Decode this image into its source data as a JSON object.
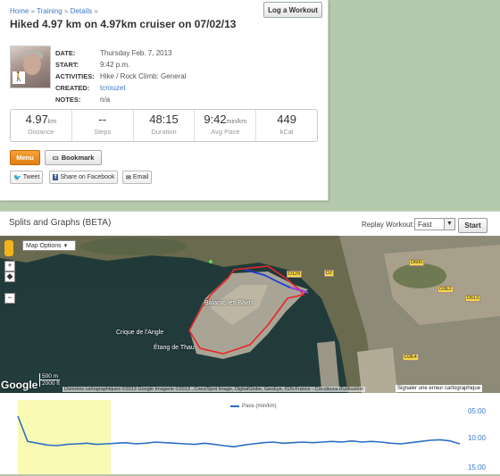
{
  "breadcrumb": {
    "home": "Home",
    "training": "Training",
    "details": "Details",
    "sep": "»"
  },
  "header": {
    "title": "Hiked 4.97 km on 4.97km cruiser on 07/02/13",
    "log_workout": "Log a Workout"
  },
  "meta": {
    "date_label": "DATE:",
    "date_value": "Thursday Feb. 7, 2013",
    "start_label": "START:",
    "start_value": "9:42 p.m.",
    "activities_label": "ACTIVITIES:",
    "activities_value": "Hike / Rock Climb: General",
    "created_label": "CREATED:",
    "created_value": "tcrouzet",
    "notes_label": "NOTES:",
    "notes_value": "n/a"
  },
  "stats": [
    {
      "value": "4.97",
      "unit": "km",
      "label": "Distance"
    },
    {
      "value": "--",
      "unit": "",
      "label": "Steps"
    },
    {
      "value": "48:15",
      "unit": "",
      "label": "Duration"
    },
    {
      "value": "9:42",
      "unit": "min/km",
      "label": "Avg Pace"
    },
    {
      "value": "449",
      "unit": "",
      "label": "kCal"
    }
  ],
  "actions": {
    "menu": "Menu",
    "bookmark": "Bookmark",
    "tweet": "Tweet",
    "facebook": "Share on Facebook",
    "email": "Email"
  },
  "splits": {
    "title": "Splits and Graphs (BETA)",
    "replay_label": "Replay Workout:",
    "replay_value": "Fast",
    "start": "Start"
  },
  "map": {
    "options": "Map Options",
    "google": "Google",
    "scale_m": "500 m",
    "scale_ft": "2000 ft",
    "attribution": "Données cartographiques ©2013 Google Imagerie ©2013 , Cnes/Spot Image, DigitalGlobe, GeoEye, IGN-France - Conditions d'utilisation",
    "report_error": "Signaler une erreur cartographique",
    "town": "Balaruc-les-Bains",
    "lagoon1": "Crique de l'Angle",
    "lagoon2": "Étang de Thau",
    "roads": [
      "D129",
      "D2",
      "D600",
      "D2E2",
      "D613",
      "D2E4"
    ],
    "colors": {
      "route_red": "#e8262b",
      "route_blue": "#1d3fd6",
      "route_purple": "#a73ad8"
    }
  },
  "chart_data": {
    "type": "line",
    "series": [
      {
        "name": "Pace (min/km)",
        "color": "#2a6fc4",
        "values": [
          5.6,
          9.9,
          10.2,
          10.5,
          10.6,
          10.4,
          10.3,
          10.2,
          10.4,
          10.3,
          10.2,
          10.1,
          10.3,
          10.2,
          10.0,
          10.1,
          10.2,
          10.3,
          10.4,
          10.2,
          10.4,
          10.6,
          10.8,
          10.5,
          10.3,
          10.1,
          10.0,
          10.2,
          10.1,
          10.0,
          10.1,
          10.0,
          9.9,
          10.0,
          9.8,
          10.0,
          9.9,
          10.0,
          10.2,
          10.3,
          10.1,
          9.9,
          9.7,
          9.6,
          9.8,
          10.3
        ]
      }
    ],
    "y_ticks": [
      "05:00",
      "10:00",
      "15:00"
    ],
    "ylim": [
      5,
      15
    ],
    "y_inverted": true,
    "highlight": {
      "from": 0.0,
      "to": 0.21
    },
    "colors": {
      "line": "#2a6fc4",
      "highlight": "#fafab4",
      "axis_text": "#3a79c8"
    }
  }
}
